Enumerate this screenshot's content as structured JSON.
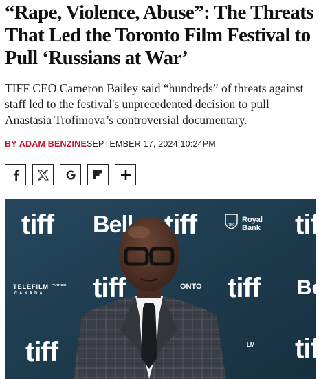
{
  "headline": "“Rape, Violence, Abuse”: The Threats That Led the Toronto Film Festival to Pull ‘Russians at War’",
  "dek": "TIFF CEO Cameron Bailey said “hundreds” of threats against staff led to the festival's unprecedented decision to pull Anastasia Trofimova’s controversial documentary.",
  "byline": {
    "prefix": "BY ",
    "author": "ADAM BENZINE",
    "date": "SEPTEMBER 17, 2024 10:24PM"
  },
  "share": [
    {
      "name": "facebook",
      "icon": "facebook-icon",
      "glyph": "f"
    },
    {
      "name": "x",
      "icon": "x-icon",
      "glyph": "X"
    },
    {
      "name": "google",
      "icon": "google-icon",
      "glyph": "G"
    },
    {
      "name": "flipboard",
      "icon": "flipboard-icon",
      "glyph": "flipboard"
    },
    {
      "name": "more",
      "icon": "plus-icon",
      "glyph": "+"
    }
  ],
  "hero": {
    "backdrop_logos": {
      "tiff": "tiff",
      "bell": "Bell",
      "royal_bank": "Royal Bank",
      "rbc": "RBC",
      "telefilm": "TELEFILM",
      "telefilm_sub": "C A N A D A",
      "telefilm_partner": "PARTNER",
      "onto": "ONTO",
      "lm": "LM",
      "be": "Be"
    },
    "colors": {
      "backdrop": "#1f3d52",
      "logo": "#ffffff"
    }
  },
  "colors": {
    "accent": "#c8102e",
    "text": "#111111"
  }
}
